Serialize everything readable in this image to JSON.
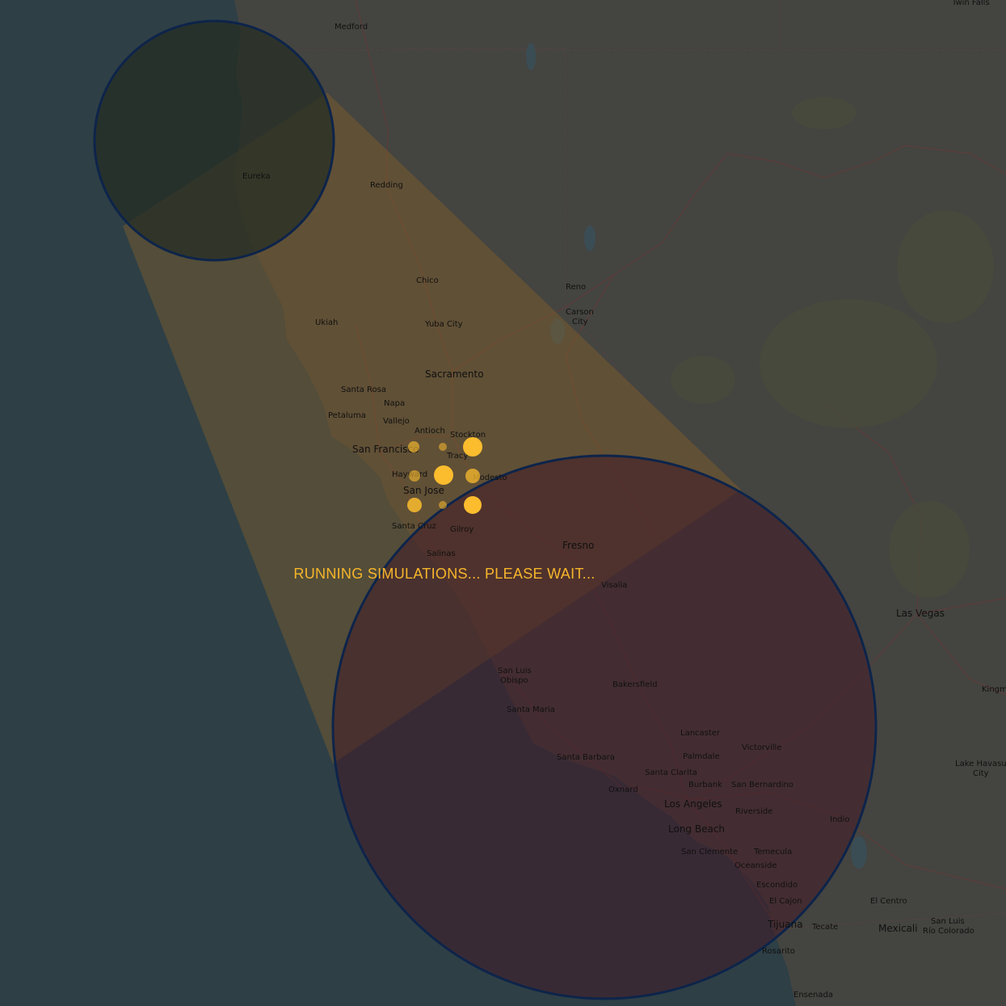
{
  "map": {
    "cities": [
      {
        "id": "medford",
        "label": "Medford"
      },
      {
        "id": "twin-falls",
        "label": "Twin Falls"
      },
      {
        "id": "eureka",
        "label": "Eureka"
      },
      {
        "id": "redding",
        "label": "Redding"
      },
      {
        "id": "chico",
        "label": "Chico"
      },
      {
        "id": "reno",
        "label": "Reno"
      },
      {
        "id": "carson",
        "label": "Carson"
      },
      {
        "id": "city",
        "label": "City"
      },
      {
        "id": "ukiah",
        "label": "Ukiah"
      },
      {
        "id": "yuba-city",
        "label": "Yuba City"
      },
      {
        "id": "sacramento",
        "label": "Sacramento"
      },
      {
        "id": "santa-rosa",
        "label": "Santa Rosa"
      },
      {
        "id": "napa",
        "label": "Napa"
      },
      {
        "id": "petaluma",
        "label": "Petaluma"
      },
      {
        "id": "vallejo",
        "label": "Vallejo"
      },
      {
        "id": "antioch",
        "label": "Antioch"
      },
      {
        "id": "stockton",
        "label": "Stockton"
      },
      {
        "id": "san-francisco",
        "label": "San Francisco"
      },
      {
        "id": "tracy",
        "label": "Tracy"
      },
      {
        "id": "hayward",
        "label": "Hayward"
      },
      {
        "id": "modesto",
        "label": "Modesto"
      },
      {
        "id": "san-jose",
        "label": "San Jose"
      },
      {
        "id": "santa-cruz",
        "label": "Santa Cruz"
      },
      {
        "id": "gilroy",
        "label": "Gilroy"
      },
      {
        "id": "salinas",
        "label": "Salinas"
      },
      {
        "id": "fresno",
        "label": "Fresno"
      },
      {
        "id": "visalia",
        "label": "Visalia"
      },
      {
        "id": "las-vegas",
        "label": "Las Vegas"
      },
      {
        "id": "san-luis",
        "label": "San Luis"
      },
      {
        "id": "obispo",
        "label": "Obispo"
      },
      {
        "id": "bakersfield",
        "label": "Bakersfield"
      },
      {
        "id": "kingman",
        "label": "Kingm"
      },
      {
        "id": "santa-maria",
        "label": "Santa Maria"
      },
      {
        "id": "lancaster",
        "label": "Lancaster"
      },
      {
        "id": "victorville",
        "label": "Victorville"
      },
      {
        "id": "palmdale",
        "label": "Palmdale"
      },
      {
        "id": "santa-barbara",
        "label": "Santa Barbara"
      },
      {
        "id": "lake-havasu",
        "label": "Lake Havasu"
      },
      {
        "id": "lake-havasu-city",
        "label": "City"
      },
      {
        "id": "santa-clarita",
        "label": "Santa Clarita"
      },
      {
        "id": "burbank",
        "label": "Burbank"
      },
      {
        "id": "san-bernardino",
        "label": "San Bernardino"
      },
      {
        "id": "oxnard",
        "label": "Oxnard"
      },
      {
        "id": "los-angeles",
        "label": "Los Angeles"
      },
      {
        "id": "riverside",
        "label": "Riverside"
      },
      {
        "id": "indio",
        "label": "Indio"
      },
      {
        "id": "long-beach",
        "label": "Long Beach"
      },
      {
        "id": "san-clemente",
        "label": "San Clemente"
      },
      {
        "id": "temecula",
        "label": "Temecula"
      },
      {
        "id": "oceanside",
        "label": "Oceanside"
      },
      {
        "id": "escondido",
        "label": "Escondido"
      },
      {
        "id": "el-centro",
        "label": "El Centro"
      },
      {
        "id": "el-cajon",
        "label": "El Cajon"
      },
      {
        "id": "san-luis-rio",
        "label": "San Luis"
      },
      {
        "id": "tijuana",
        "label": "Tijuana"
      },
      {
        "id": "tecate",
        "label": "Tecate"
      },
      {
        "id": "mexicali",
        "label": "Mexicali"
      },
      {
        "id": "rio-colorado",
        "label": "Río Colorado"
      },
      {
        "id": "rosarito",
        "label": "Rosarito"
      },
      {
        "id": "ensenada",
        "label": "Ensenada"
      }
    ]
  },
  "colors": {
    "ocean": "#2f3d42",
    "land": "#4a4a4a",
    "cone": "#e8a33a",
    "circle_stroke": "#163a78",
    "target_fill": "#6a2a40",
    "loader": "#fbbc2e"
  },
  "loading": {
    "message": "RUNNING SIMULATIONS... PLEASE WAIT..."
  }
}
